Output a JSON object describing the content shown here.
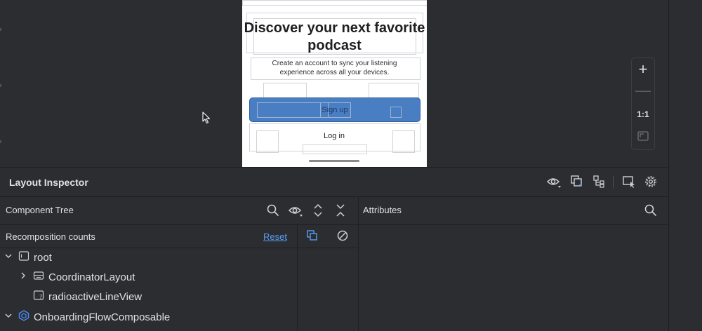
{
  "preview": {
    "title": "Discover your next favorite podcast",
    "subtitle": "Create an account to sync your listening experience across all your devices.",
    "signup_label": "Sign up",
    "login_label": "Log in"
  },
  "zoom_controls": {
    "zoom_in": "+",
    "zoom_out": "—",
    "actual_size": "1:1"
  },
  "inspector": {
    "title": "Layout Inspector",
    "toolbar_icons": [
      "eye-icon",
      "snapshot-icon",
      "layer-spacing-icon",
      "select-pointer-icon",
      "gear-icon"
    ]
  },
  "component_tree": {
    "title": "Component Tree",
    "header_icons": [
      "search-icon",
      "eye-icon",
      "expand-icon",
      "collapse-icon"
    ],
    "recomposition_label": "Recomposition counts",
    "reset_label": "Reset",
    "nodes": [
      {
        "label": "root",
        "expanded": true,
        "depth": 0,
        "icon": "view-icon"
      },
      {
        "label": "CoordinatorLayout",
        "expanded": false,
        "depth": 1,
        "icon": "layout-icon"
      },
      {
        "label": "radioactiveLineView",
        "expanded": null,
        "depth": 1,
        "icon": "unknown-view-icon"
      },
      {
        "label": "OnboardingFlowComposable",
        "expanded": true,
        "depth": 0,
        "icon": "compose-icon"
      }
    ]
  },
  "attributes": {
    "title": "Attributes"
  },
  "colors": {
    "background": "#2b2d30",
    "link": "#589df6",
    "signup_button": "#4a7ec2",
    "compose_icon": "#4c8df6"
  }
}
